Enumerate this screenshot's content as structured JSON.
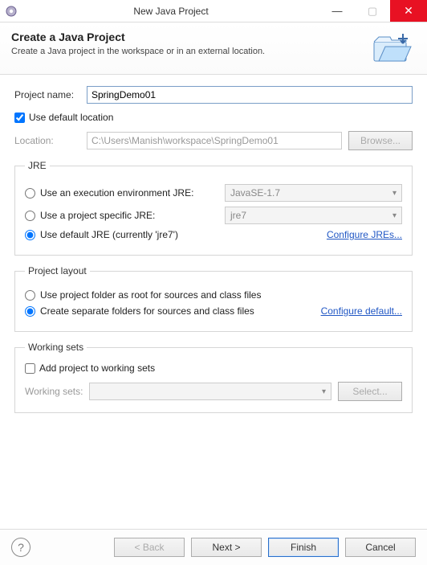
{
  "titlebar": {
    "title": "New Java Project"
  },
  "banner": {
    "heading": "Create a Java Project",
    "subtext": "Create a Java project in the workspace or in an external location."
  },
  "project": {
    "name_label": "Project name:",
    "name_value": "SpringDemo01",
    "use_default_label": "Use default location",
    "location_label": "Location:",
    "location_value": "C:\\Users\\Manish\\workspace\\SpringDemo01",
    "browse_label": "Browse..."
  },
  "jre": {
    "legend": "JRE",
    "exec_env_label": "Use an execution environment JRE:",
    "exec_env_value": "JavaSE-1.7",
    "project_specific_label": "Use a project specific JRE:",
    "project_specific_value": "jre7",
    "default_label": "Use default JRE (currently 'jre7')",
    "configure_link": "Configure JREs..."
  },
  "layout": {
    "legend": "Project layout",
    "root_label": "Use project folder as root for sources and class files",
    "separate_label": "Create separate folders for sources and class files",
    "configure_link": "Configure default..."
  },
  "workingsets": {
    "legend": "Working sets",
    "add_label": "Add project to working sets",
    "combo_label": "Working sets:",
    "select_label": "Select..."
  },
  "footer": {
    "back": "< Back",
    "next": "Next >",
    "finish": "Finish",
    "cancel": "Cancel"
  }
}
